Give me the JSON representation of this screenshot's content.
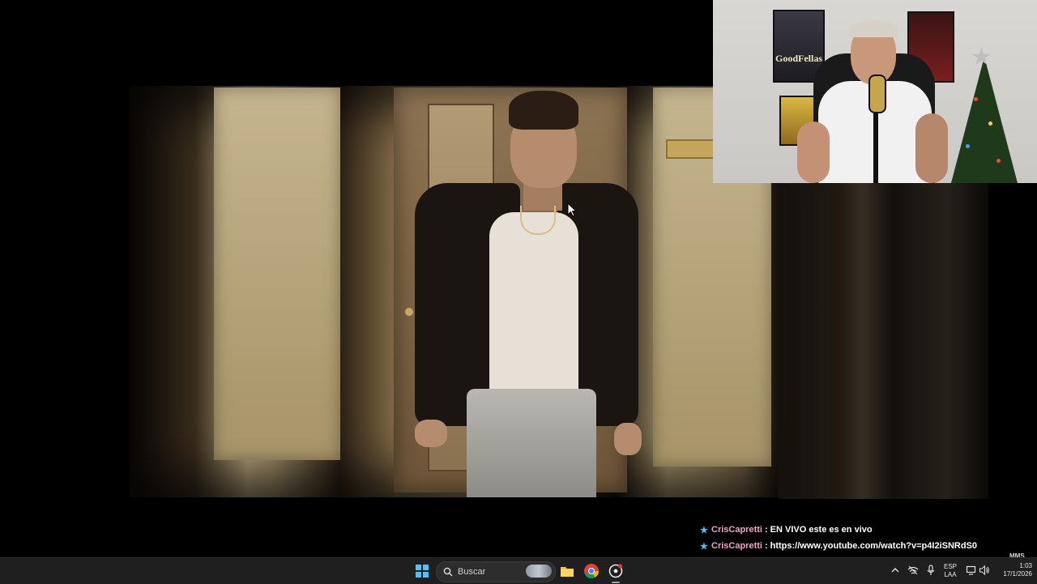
{
  "webcam": {
    "poster_left_title": "GoodFellas"
  },
  "chat": {
    "messages": [
      {
        "user": "CrisCapretti",
        "separator": ":",
        "text": "EN VIVO este es en vivo"
      },
      {
        "user": "CrisCapretti",
        "separator": ":",
        "text": "https://www.youtube.com/watch?v=p4I2iSNRdS0"
      }
    ]
  },
  "overlay": {
    "corner_text": "MMS"
  },
  "taskbar": {
    "search_placeholder": "Buscar",
    "icons": [
      "windows-start-icon",
      "search-icon",
      "file-explorer-icon",
      "chrome-icon",
      "obs-recording-app-icon"
    ],
    "tray": {
      "language_line1": "ESP",
      "language_line2": "LAA",
      "time": "1:03",
      "date": "17/1/2026",
      "icons": [
        "chevron-up-icon",
        "network-off-icon",
        "microphone-icon",
        "display-icon",
        "volume-icon"
      ]
    }
  },
  "colors": {
    "taskbar_bg": "#1f1f1f",
    "chat_username": "#f0a0c8",
    "chat_star": "#4fc0f0",
    "start_blue": "#4cc2ff"
  }
}
